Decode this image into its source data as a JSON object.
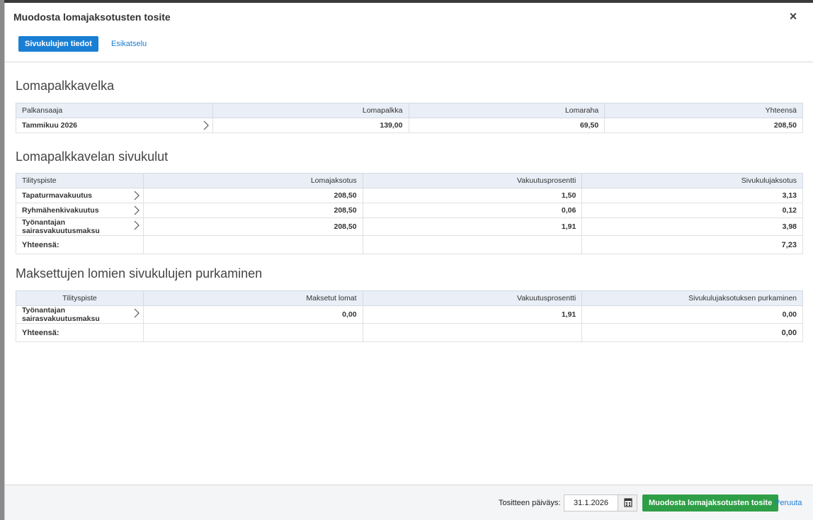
{
  "dialog": {
    "title": "Muodosta lomajaksotusten tosite",
    "close_label": "×",
    "tabs": [
      {
        "label": "Sivukulujen tiedot",
        "active": true
      },
      {
        "label": "Esikatselu",
        "active": false
      }
    ]
  },
  "section1": {
    "title": "Lomapalkkavelka",
    "headers": [
      "Palkansaaja",
      "Lomapalkka",
      "Lomaraha",
      "Yhteensä"
    ],
    "rows": [
      {
        "label": "Tammikuu 2026",
        "lomapalkka": "139,00",
        "lomaraha": "69,50",
        "yhteensa": "208,50"
      }
    ]
  },
  "section2": {
    "title": "Lomapalkkavelan sivukulut",
    "headers": [
      "Tilityspiste",
      "Lomajaksotus",
      "Vakuutusprosentti",
      "Sivukulujaksotus"
    ],
    "rows": [
      {
        "label": "Tapaturmavakuutus",
        "jaksotus": "208,50",
        "prosentti": "1,50",
        "sivukulu": "3,13"
      },
      {
        "label": "Ryhmähenkivakuutus",
        "jaksotus": "208,50",
        "prosentti": "0,06",
        "sivukulu": "0,12"
      },
      {
        "label": "Työnantajan sairasvakuutusmaksu",
        "jaksotus": "208,50",
        "prosentti": "1,91",
        "sivukulu": "3,98"
      }
    ],
    "total_label": "Yhteensä:",
    "total_value": "7,23"
  },
  "section3": {
    "title": "Maksettujen lomien sivukulujen purkaminen",
    "headers": [
      "Tilityspiste",
      "Maksetut lomat",
      "Vakuutusprosentti",
      "Sivukulujaksotuksen purkaminen"
    ],
    "rows": [
      {
        "label": "Työnantajan sairasvakuutusmaksu",
        "maksetut": "0,00",
        "prosentti": "1,91",
        "purkaminen": "0,00"
      }
    ],
    "total_label": "Yhteensä:",
    "total_value": "0,00"
  },
  "footer": {
    "date_label": "Tositteen päiväys:",
    "date_value": "31.1.2026",
    "create_button": "Muodosta lomajaksotusten tosite",
    "cancel_label": "Peruuta"
  },
  "colors": {
    "accent": "#1a7fd4",
    "success": "#2e9e47",
    "table_header": "#e9eef7"
  }
}
